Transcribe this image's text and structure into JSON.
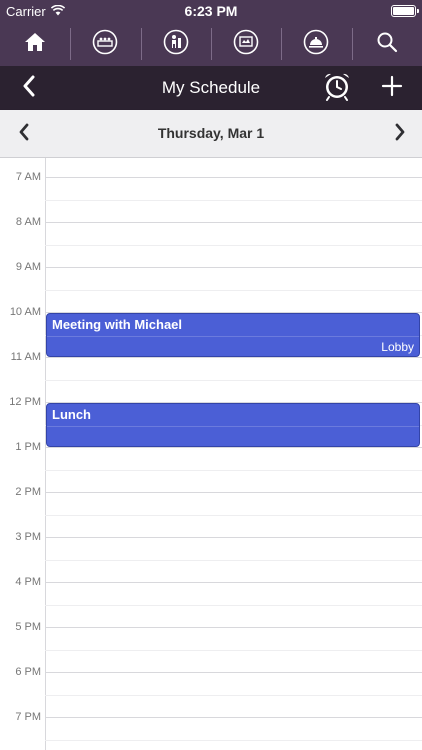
{
  "status_bar": {
    "carrier": "Carrier",
    "time": "6:23 PM"
  },
  "nav_icons": [
    "home-icon",
    "hotel-front-desk-icon",
    "guest-services-icon",
    "room-icon",
    "concierge-bell-icon",
    "search-icon"
  ],
  "header": {
    "title": "My Schedule",
    "back_icon": "chevron-left-icon",
    "alarm_icon": "alarm-clock-icon",
    "add_icon": "plus-icon"
  },
  "date_nav": {
    "date": "Thursday, Mar 1"
  },
  "schedule": {
    "hours": [
      "7 AM",
      "8 AM",
      "9 AM",
      "10 AM",
      "11 AM",
      "12 PM",
      "1 PM",
      "2 PM",
      "3 PM",
      "4 PM",
      "5 PM",
      "6 PM",
      "7 PM"
    ],
    "events": [
      {
        "title": "Meeting with Michael",
        "location": "Lobby",
        "start": "10:00",
        "end": "11:00"
      },
      {
        "title": "Lunch",
        "location": "",
        "start": "12:00",
        "end": "13:00"
      }
    ]
  },
  "colors": {
    "nav_bg": "#4a3854",
    "title_bg": "#2b2230",
    "event_bg": "#4b5fd6"
  }
}
